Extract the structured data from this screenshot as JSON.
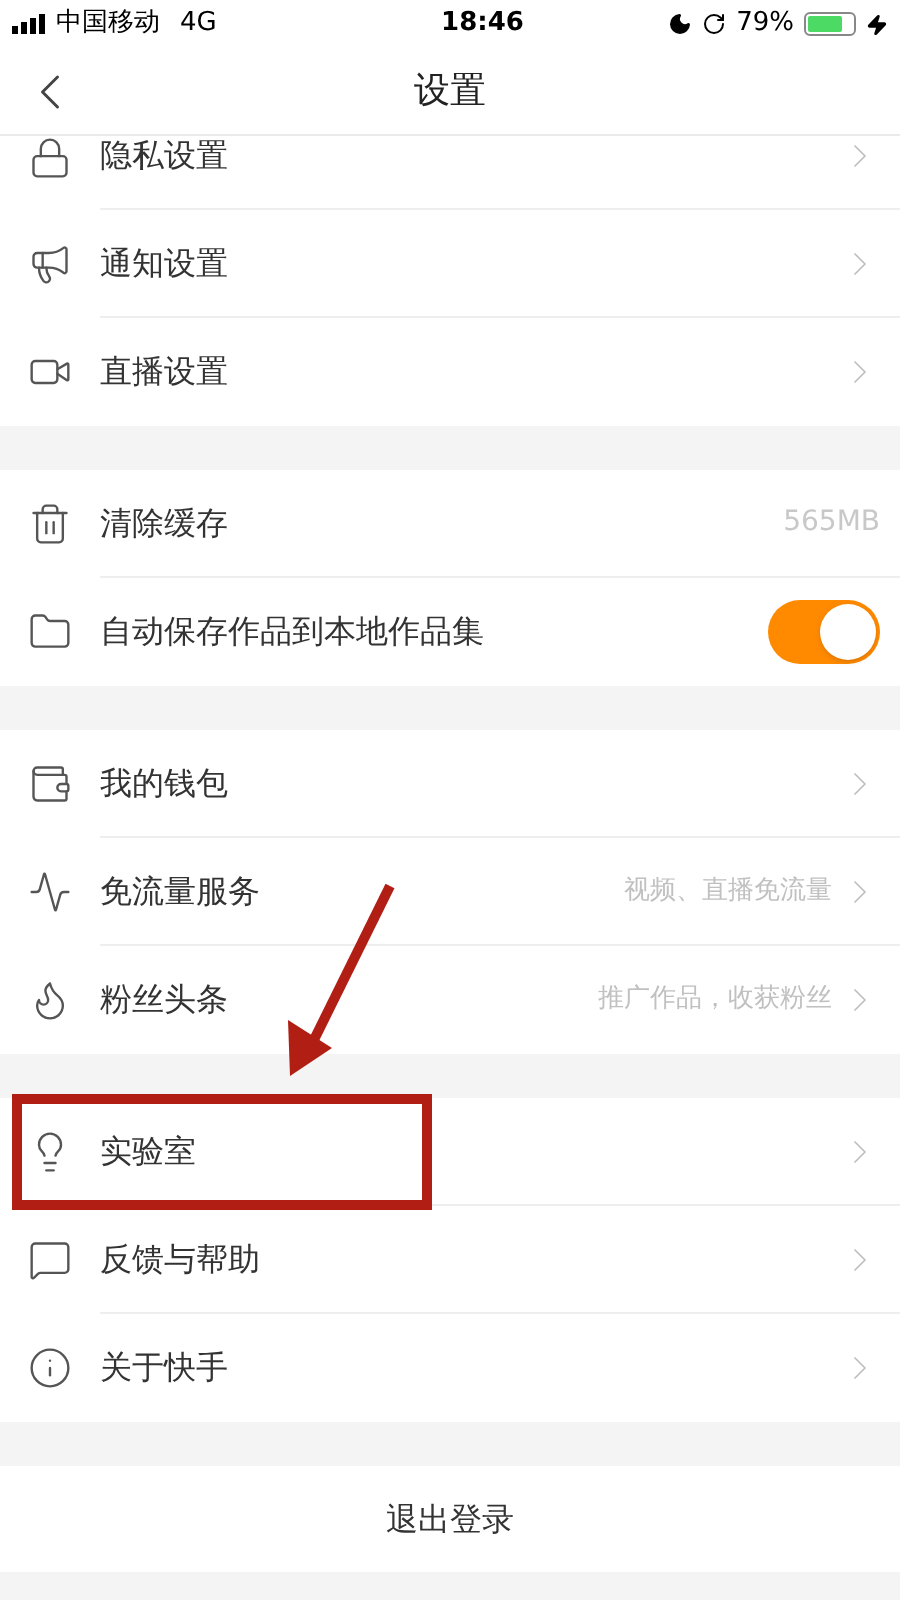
{
  "status_bar": {
    "carrier": "中国移动",
    "network": "4G",
    "time": "18:46",
    "battery": "79%"
  },
  "nav": {
    "title": "设置"
  },
  "sections": [
    {
      "rows": [
        {
          "kind": "chevron",
          "label": "隐私设置",
          "partial": true
        },
        {
          "kind": "chevron",
          "label": "通知设置"
        },
        {
          "kind": "chevron",
          "label": "直播设置"
        }
      ]
    },
    {
      "rows": [
        {
          "kind": "value",
          "label": "清除缓存",
          "value": "565MB"
        },
        {
          "kind": "toggle",
          "label": "自动保存作品到本地作品集",
          "on": true
        }
      ]
    },
    {
      "rows": [
        {
          "kind": "chevron",
          "label": "我的钱包"
        },
        {
          "kind": "chevron",
          "label": "免流量服务",
          "hint": "视频、直播免流量"
        },
        {
          "kind": "chevron",
          "label": "粉丝头条",
          "hint": "推广作品，收获粉丝"
        }
      ]
    },
    {
      "rows": [
        {
          "kind": "chevron",
          "label": "实验室",
          "highlighted": true
        },
        {
          "kind": "chevron",
          "label": "反馈与帮助"
        },
        {
          "kind": "chevron",
          "label": "关于快手"
        }
      ]
    }
  ],
  "logout": {
    "label": "退出登录"
  }
}
